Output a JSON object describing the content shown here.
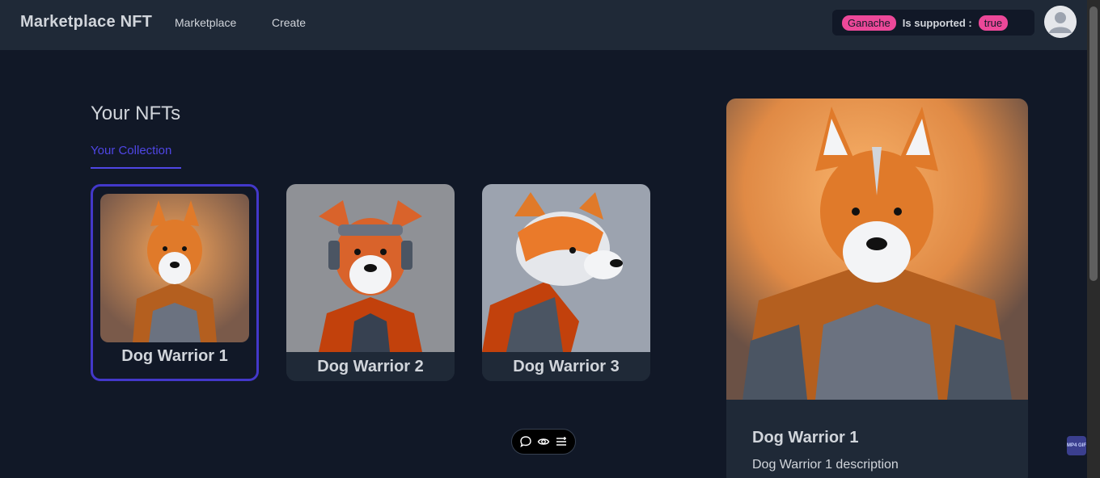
{
  "navbar": {
    "brand": "Marketplace NFT",
    "links": [
      "Marketplace",
      "Create"
    ],
    "network_name": "Ganache",
    "supported_label": "Is supported :",
    "supported_value": "true"
  },
  "main": {
    "title": "Your NFTs",
    "tab": "Your Collection",
    "nfts": [
      {
        "name": "Dog Warrior 1",
        "selected": true
      },
      {
        "name": "Dog Warrior 2",
        "selected": false
      },
      {
        "name": "Dog Warrior 3",
        "selected": false
      }
    ]
  },
  "detail": {
    "name": "Dog Warrior 1",
    "description": "Dog Warrior 1 description"
  },
  "toolbar": {
    "icons": [
      "chat-icon",
      "eye-icon",
      "list-icon"
    ]
  },
  "badge": {
    "label": "MP4 GIF"
  },
  "colors": {
    "background": "#111827",
    "navbar": "#1f2937",
    "accent": "#4f46e5",
    "pill": "#ec4899"
  }
}
